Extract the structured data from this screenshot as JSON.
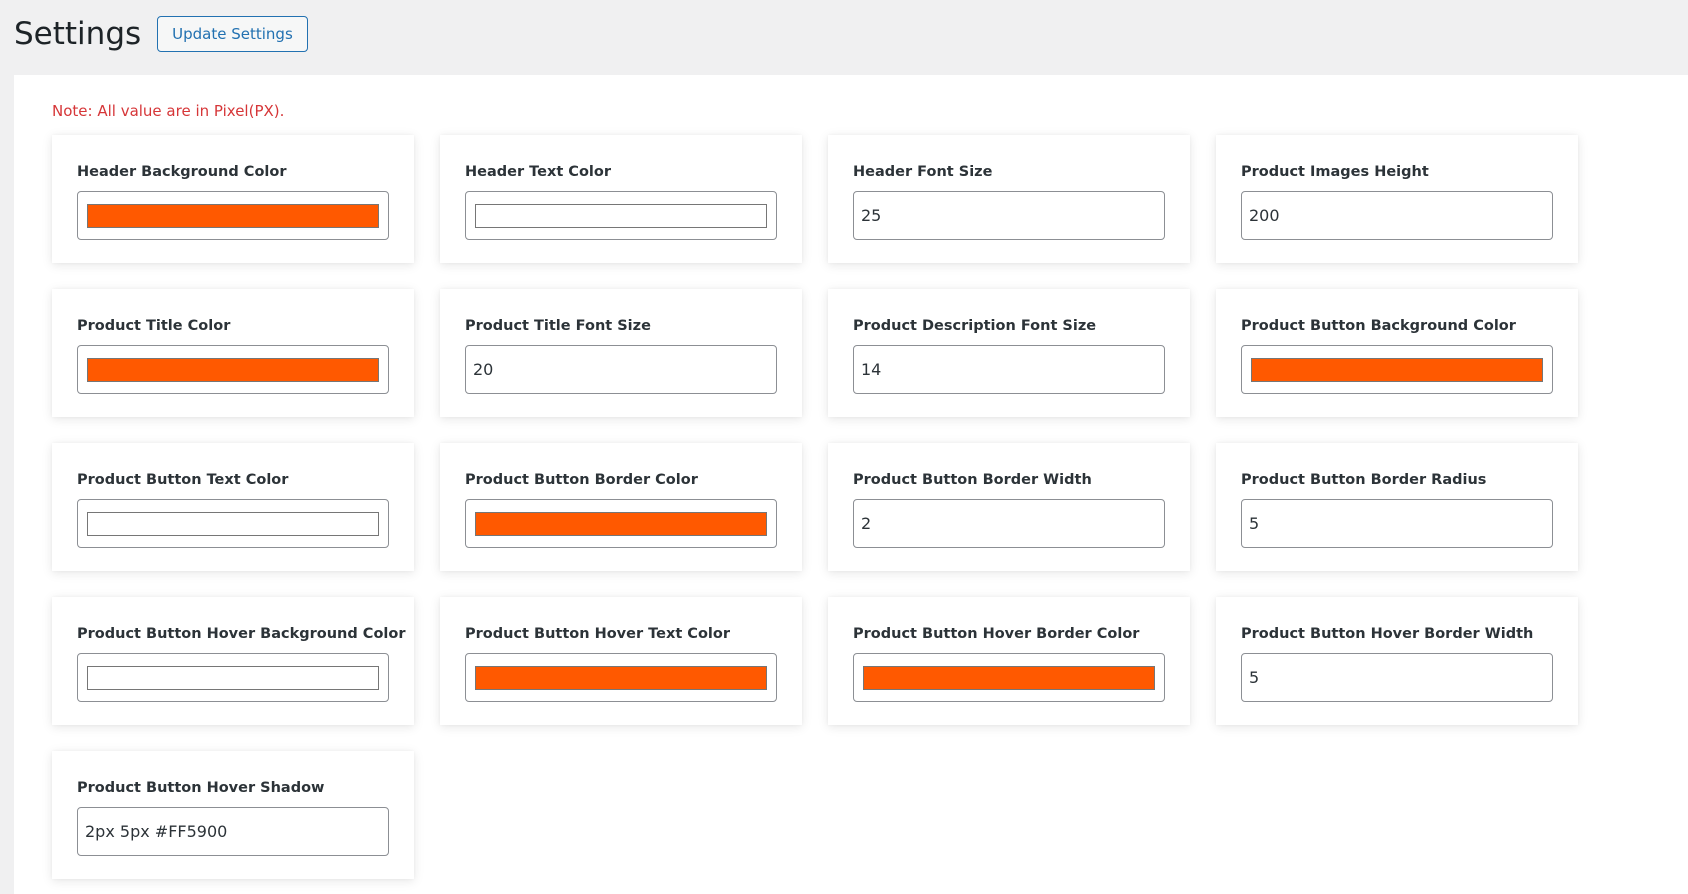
{
  "header": {
    "title": "Settings",
    "update_button_label": "Update Settings"
  },
  "note": "Note: All value are in Pixel(PX).",
  "colors": {
    "accent": "#2271b1",
    "note_red": "#d63638",
    "orange": "#FF5900",
    "white": "#FFFFFF"
  },
  "fields": [
    {
      "label": "Header Background Color",
      "type": "color",
      "value": "#FF5900"
    },
    {
      "label": "Header Text Color",
      "type": "color",
      "value": "#FFFFFF"
    },
    {
      "label": "Header Font Size",
      "type": "text",
      "value": "25"
    },
    {
      "label": "Product Images Height",
      "type": "text",
      "value": "200"
    },
    {
      "label": "Product Title Color",
      "type": "color",
      "value": "#FF5900"
    },
    {
      "label": "Product Title Font Size",
      "type": "text",
      "value": "20"
    },
    {
      "label": "Product Description Font Size",
      "type": "text",
      "value": "14"
    },
    {
      "label": "Product Button Background Color",
      "type": "color",
      "value": "#FF5900"
    },
    {
      "label": "Product Button Text Color",
      "type": "color",
      "value": "#FFFFFF"
    },
    {
      "label": "Product Button Border Color",
      "type": "color",
      "value": "#FF5900"
    },
    {
      "label": "Product Button Border Width",
      "type": "text",
      "value": "2"
    },
    {
      "label": "Product Button Border Radius",
      "type": "text",
      "value": "5"
    },
    {
      "label": "Product Button Hover Background Color",
      "type": "color",
      "value": "#FFFFFF"
    },
    {
      "label": "Product Button Hover Text Color",
      "type": "color",
      "value": "#FF5900"
    },
    {
      "label": "Product Button Hover Border Color",
      "type": "color",
      "value": "#FF5900"
    },
    {
      "label": "Product Button Hover Border Width",
      "type": "text",
      "value": "5"
    },
    {
      "label": "Product Button Hover Shadow",
      "type": "text",
      "value": "2px 5px #FF5900"
    }
  ]
}
